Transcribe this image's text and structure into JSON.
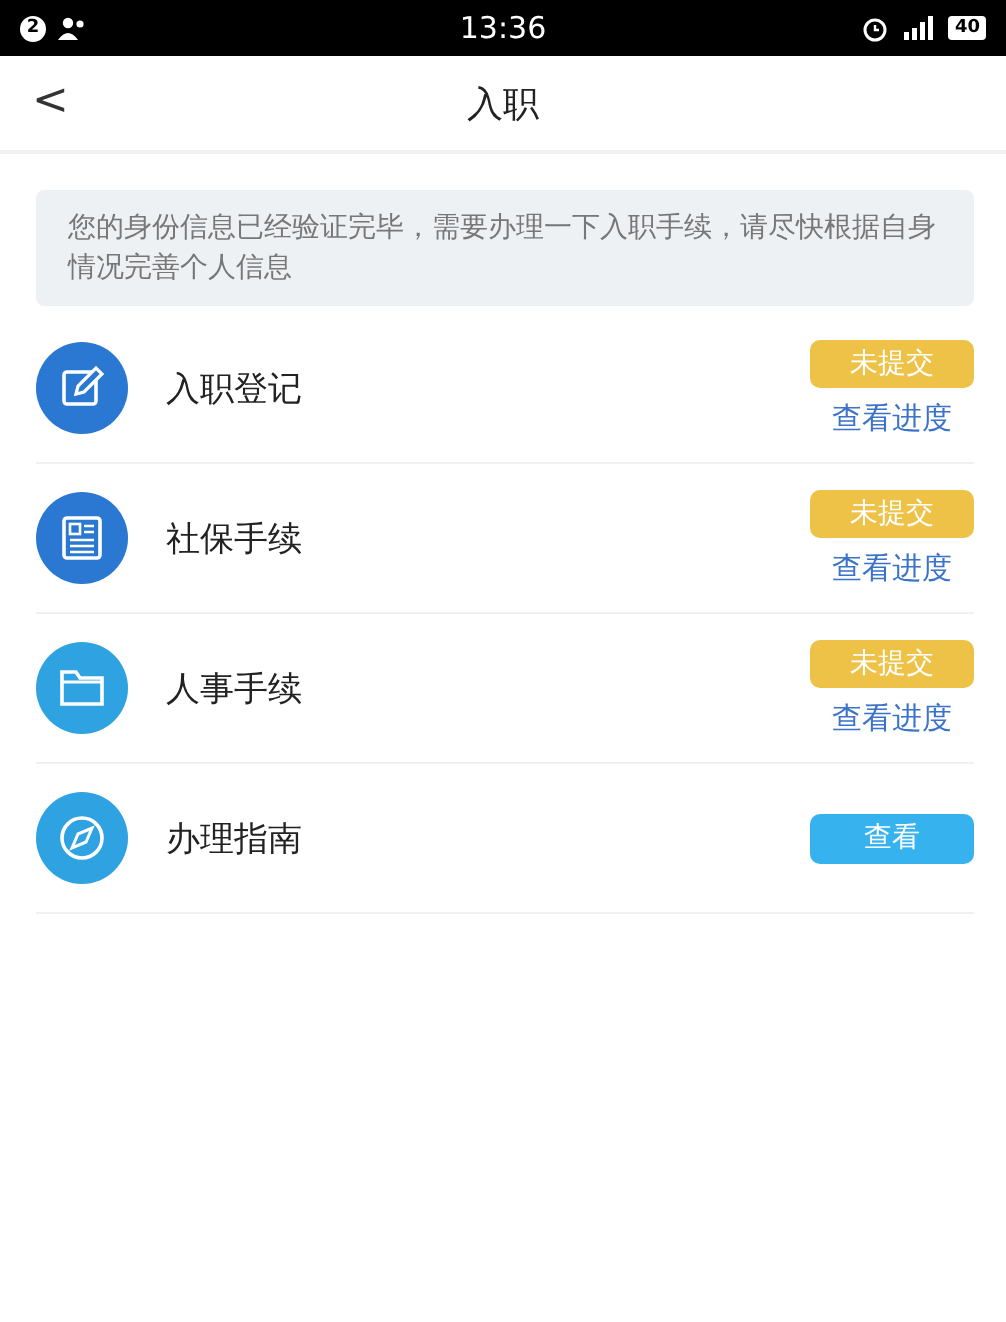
{
  "status_bar": {
    "notification_count": "2",
    "time": "13:36",
    "battery": "40"
  },
  "nav": {
    "back": "<",
    "title": "入职"
  },
  "notice": "您的身份信息已经验证完毕，需要办理一下入职手续，请尽快根据自身情况完善个人信息",
  "items": [
    {
      "kind": "status",
      "label": "入职登记",
      "color": "#2a78d2",
      "badge": "未提交",
      "link": "查看进度"
    },
    {
      "kind": "status",
      "label": "社保手续",
      "color": "#2a78d2",
      "badge": "未提交",
      "link": "查看进度"
    },
    {
      "kind": "status",
      "label": "人事手续",
      "color": "#2fa2e2",
      "badge": "未提交",
      "link": "查看进度"
    },
    {
      "kind": "view",
      "label": "办理指南",
      "color": "#2fa2e2",
      "button": "查看"
    }
  ]
}
